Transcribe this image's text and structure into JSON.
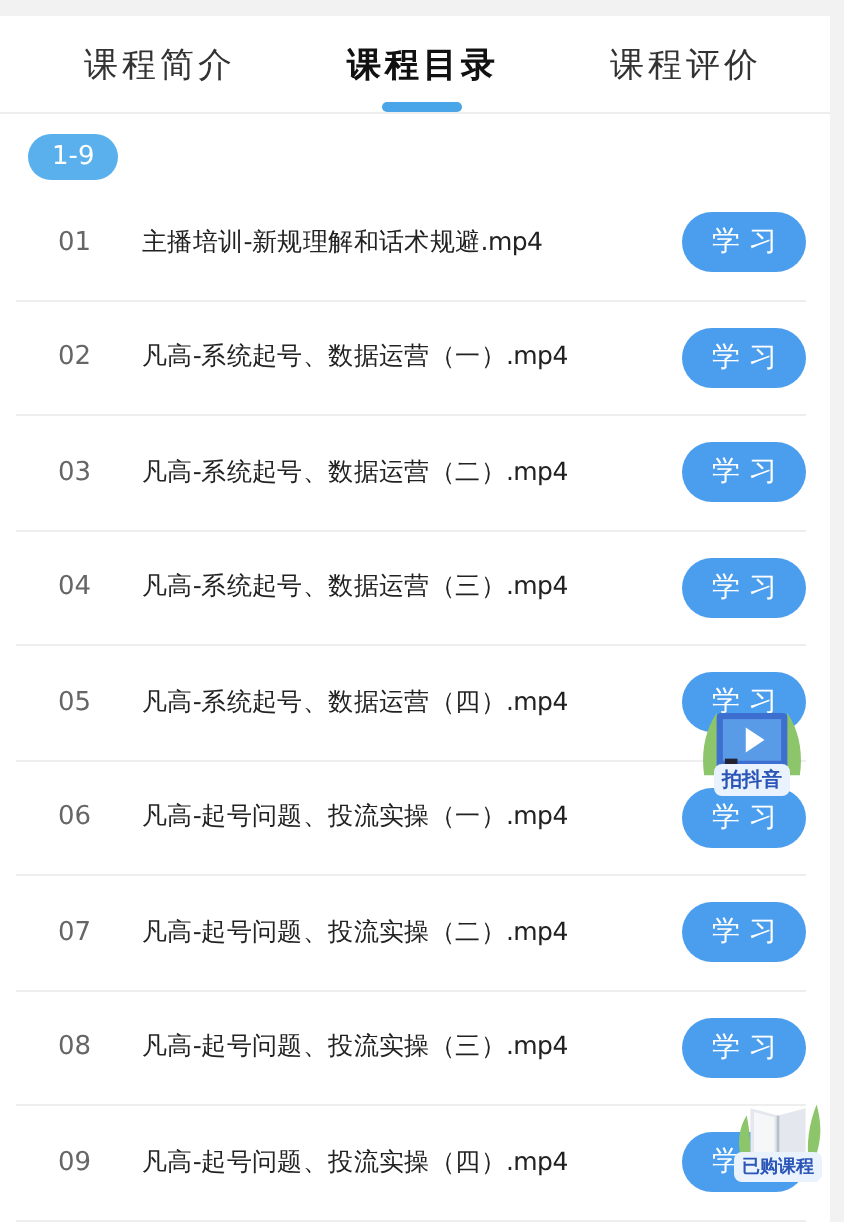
{
  "tabs": [
    {
      "label": "课程简介",
      "selected": false
    },
    {
      "label": "课程目录",
      "selected": true
    },
    {
      "label": "课程评价",
      "selected": false
    }
  ],
  "range_chip": {
    "label": "1-9"
  },
  "lessons": [
    {
      "number": "01",
      "title": "主播培训-新规理解和话术规避.mp4",
      "button": "学 习"
    },
    {
      "number": "02",
      "title": "凡高-系统起号、数据运营（一）.mp4",
      "button": "学 习"
    },
    {
      "number": "03",
      "title": "凡高-系统起号、数据运营（二）.mp4",
      "button": "学 习"
    },
    {
      "number": "04",
      "title": "凡高-系统起号、数据运营（三）.mp4",
      "button": "学 习"
    },
    {
      "number": "05",
      "title": "凡高-系统起号、数据运营（四）.mp4",
      "button": "学 习"
    },
    {
      "number": "06",
      "title": "凡高-起号问题、投流实操（一）.mp4",
      "button": "学 习"
    },
    {
      "number": "07",
      "title": "凡高-起号问题、投流实操（二）.mp4",
      "button": "学 习"
    },
    {
      "number": "08",
      "title": "凡高-起号问题、投流实操（三）.mp4",
      "button": "学 习"
    },
    {
      "number": "09",
      "title": "凡高-起号问题、投流实操（四）.mp4",
      "button": "学"
    }
  ],
  "floating_buttons": [
    {
      "kind": "video",
      "label": "拍抖音"
    },
    {
      "kind": "book",
      "label": "已购课程"
    }
  ]
}
